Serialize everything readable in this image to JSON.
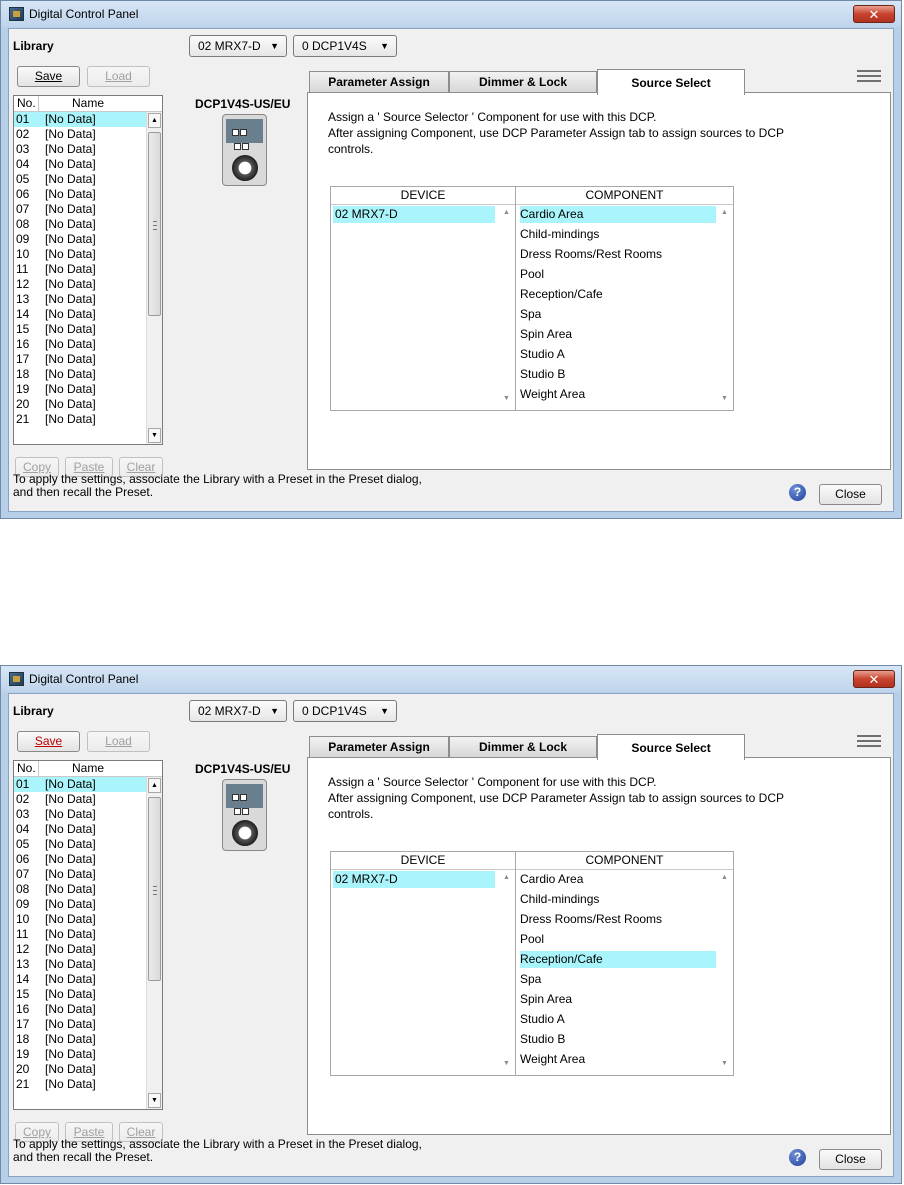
{
  "windows": [
    {
      "title": "Digital Control Panel",
      "close_glyph": "✕",
      "library_label": "Library",
      "save_label": "Save",
      "load_label": "Load",
      "device_dropdown": "02 MRX7-D",
      "dcp_dropdown": "0 DCP1V4S",
      "dropdown_arrow": "▼",
      "list_header_no": "No.",
      "list_header_name": "Name",
      "library_rows": [
        {
          "no": "01",
          "name": "[No Data]"
        },
        {
          "no": "02",
          "name": "[No Data]"
        },
        {
          "no": "03",
          "name": "[No Data]"
        },
        {
          "no": "04",
          "name": "[No Data]"
        },
        {
          "no": "05",
          "name": "[No Data]"
        },
        {
          "no": "06",
          "name": "[No Data]"
        },
        {
          "no": "07",
          "name": "[No Data]"
        },
        {
          "no": "08",
          "name": "[No Data]"
        },
        {
          "no": "09",
          "name": "[No Data]"
        },
        {
          "no": "10",
          "name": "[No Data]"
        },
        {
          "no": "11",
          "name": "[No Data]"
        },
        {
          "no": "12",
          "name": "[No Data]"
        },
        {
          "no": "13",
          "name": "[No Data]"
        },
        {
          "no": "14",
          "name": "[No Data]"
        },
        {
          "no": "15",
          "name": "[No Data]"
        },
        {
          "no": "16",
          "name": "[No Data]"
        },
        {
          "no": "17",
          "name": "[No Data]"
        },
        {
          "no": "18",
          "name": "[No Data]"
        },
        {
          "no": "19",
          "name": "[No Data]"
        },
        {
          "no": "20",
          "name": "[No Data]"
        },
        {
          "no": "21",
          "name": "[No Data]"
        }
      ],
      "copy_label": "Copy",
      "paste_label": "Paste",
      "clear_label": "Clear",
      "model_label": "DCP1V4S-US/EU",
      "tabs": [
        "Parameter Assign",
        "Dimmer & Lock",
        "Source Select"
      ],
      "desc_line1": "Assign a ' Source Selector ' Component for use with this DCP.",
      "desc_line2": "After assigning Component, use DCP Parameter Assign tab to assign sources to DCP",
      "desc_line3": "controls.",
      "device_header": "DEVICE",
      "component_header": "COMPONENT",
      "device_item": "02 MRX7-D",
      "components": [
        "Cardio Area",
        "Child-mindings",
        "Dress Rooms/Rest Rooms",
        "Pool",
        "Reception/Cafe",
        "Spa",
        "Spin Area",
        "Studio A",
        "Studio B",
        "Weight Area"
      ],
      "footer_line1": "To apply the settings, associate the Library with a Preset in the Preset dialog,",
      "footer_line2": "and then recall the Preset.",
      "help_glyph": "?",
      "close_label": "Close"
    },
    {
      "title": "Digital Control Panel",
      "close_glyph": "✕",
      "library_label": "Library",
      "save_label": "Save",
      "load_label": "Load",
      "device_dropdown": "02 MRX7-D",
      "dcp_dropdown": "0 DCP1V4S",
      "dropdown_arrow": "▼",
      "list_header_no": "No.",
      "list_header_name": "Name",
      "library_rows": [
        {
          "no": "01",
          "name": "[No Data]"
        },
        {
          "no": "02",
          "name": "[No Data]"
        },
        {
          "no": "03",
          "name": "[No Data]"
        },
        {
          "no": "04",
          "name": "[No Data]"
        },
        {
          "no": "05",
          "name": "[No Data]"
        },
        {
          "no": "06",
          "name": "[No Data]"
        },
        {
          "no": "07",
          "name": "[No Data]"
        },
        {
          "no": "08",
          "name": "[No Data]"
        },
        {
          "no": "09",
          "name": "[No Data]"
        },
        {
          "no": "10",
          "name": "[No Data]"
        },
        {
          "no": "11",
          "name": "[No Data]"
        },
        {
          "no": "12",
          "name": "[No Data]"
        },
        {
          "no": "13",
          "name": "[No Data]"
        },
        {
          "no": "14",
          "name": "[No Data]"
        },
        {
          "no": "15",
          "name": "[No Data]"
        },
        {
          "no": "16",
          "name": "[No Data]"
        },
        {
          "no": "17",
          "name": "[No Data]"
        },
        {
          "no": "18",
          "name": "[No Data]"
        },
        {
          "no": "19",
          "name": "[No Data]"
        },
        {
          "no": "20",
          "name": "[No Data]"
        },
        {
          "no": "21",
          "name": "[No Data]"
        }
      ],
      "copy_label": "Copy",
      "paste_label": "Paste",
      "clear_label": "Clear",
      "model_label": "DCP1V4S-US/EU",
      "tabs": [
        "Parameter Assign",
        "Dimmer & Lock",
        "Source Select"
      ],
      "desc_line1": "Assign a ' Source Selector ' Component for use with this DCP.",
      "desc_line2": "After assigning Component, use DCP Parameter Assign tab to assign sources to DCP",
      "desc_line3": "controls.",
      "device_header": "DEVICE",
      "component_header": "COMPONENT",
      "device_item": "02 MRX7-D",
      "components": [
        "Cardio Area",
        "Child-mindings",
        "Dress Rooms/Rest Rooms",
        "Pool",
        "Reception/Cafe",
        "Spa",
        "Spin Area",
        "Studio A",
        "Studio B",
        "Weight Area"
      ],
      "footer_line1": "To apply the settings, associate the Library with a Preset in the Preset dialog,",
      "footer_line2": "and then recall the Preset.",
      "help_glyph": "?",
      "close_label": "Close"
    }
  ],
  "selection_color": "#aaf5fb",
  "save_highlight_color": "#c00000"
}
